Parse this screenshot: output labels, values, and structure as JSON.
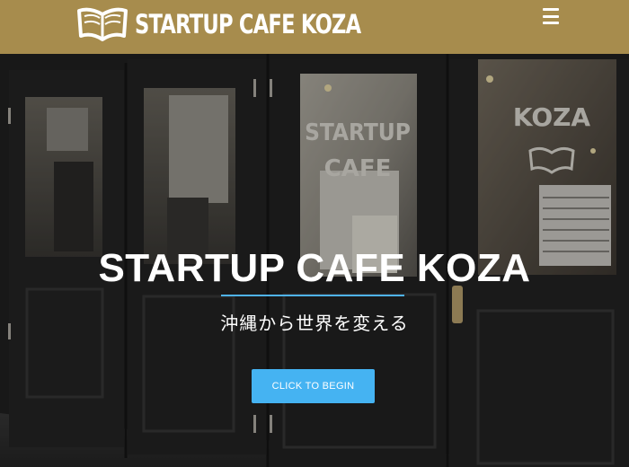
{
  "header": {
    "brand": "STARTUP CAFE KOZA"
  },
  "hero": {
    "title": "STARTUP CAFE KOZA",
    "subtitle": "沖縄から世界を変える",
    "cta_label": "CLICK TO BEGIN",
    "window_sign_left_line1": "STARTUP",
    "window_sign_left_line2": "CAFE",
    "window_sign_right": "KOZA"
  },
  "colors": {
    "header_bg": "#a78c4d",
    "accent_rule": "#4fb3f0",
    "cta_bg": "#45b3f2"
  },
  "icons": {
    "logo": "open-book-icon",
    "menu": "hamburger-menu-icon"
  }
}
